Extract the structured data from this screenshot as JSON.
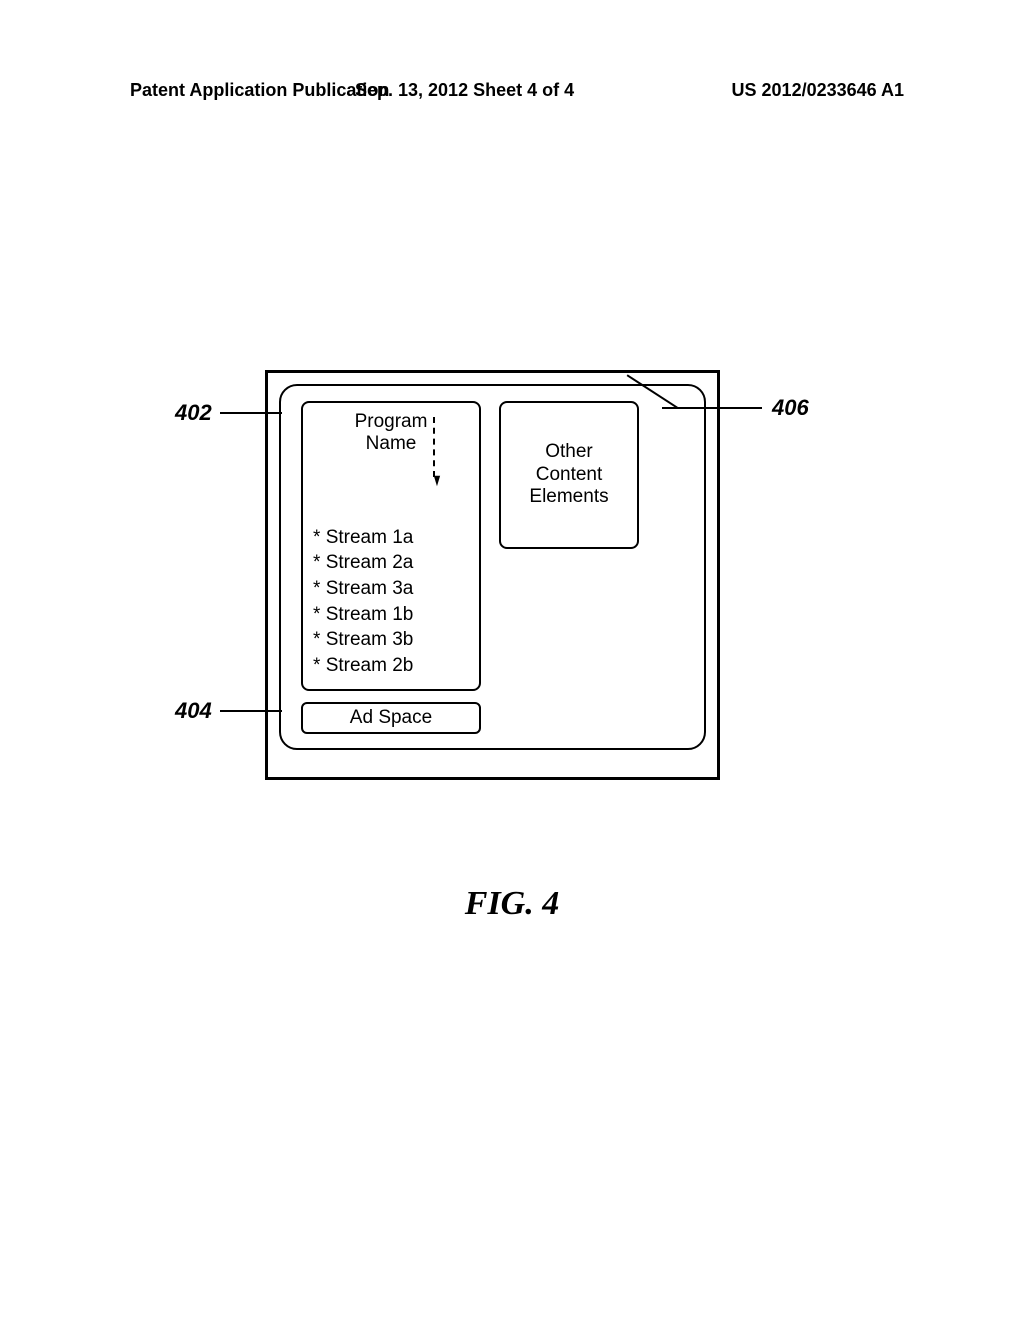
{
  "header": {
    "left": "Patent Application Publication",
    "mid": "Sep. 13, 2012  Sheet 4 of 4",
    "right": "US 2012/0233646 A1"
  },
  "callouts": {
    "c402": "402",
    "c404": "404",
    "c406": "406"
  },
  "panel_left_title_l1": "Program",
  "panel_left_title_l2": "Name",
  "streams": {
    "s1": "Stream 1a",
    "s2": "Stream 2a",
    "s3": "Stream 3a",
    "s4": "Stream 1b",
    "s5": "Stream 3b",
    "s6": "Stream 2b"
  },
  "panel_right_l1": "Other",
  "panel_right_l2": "Content",
  "panel_right_l3": "Elements",
  "ad_box": "Ad Space",
  "fig_caption": "FIG.  4"
}
